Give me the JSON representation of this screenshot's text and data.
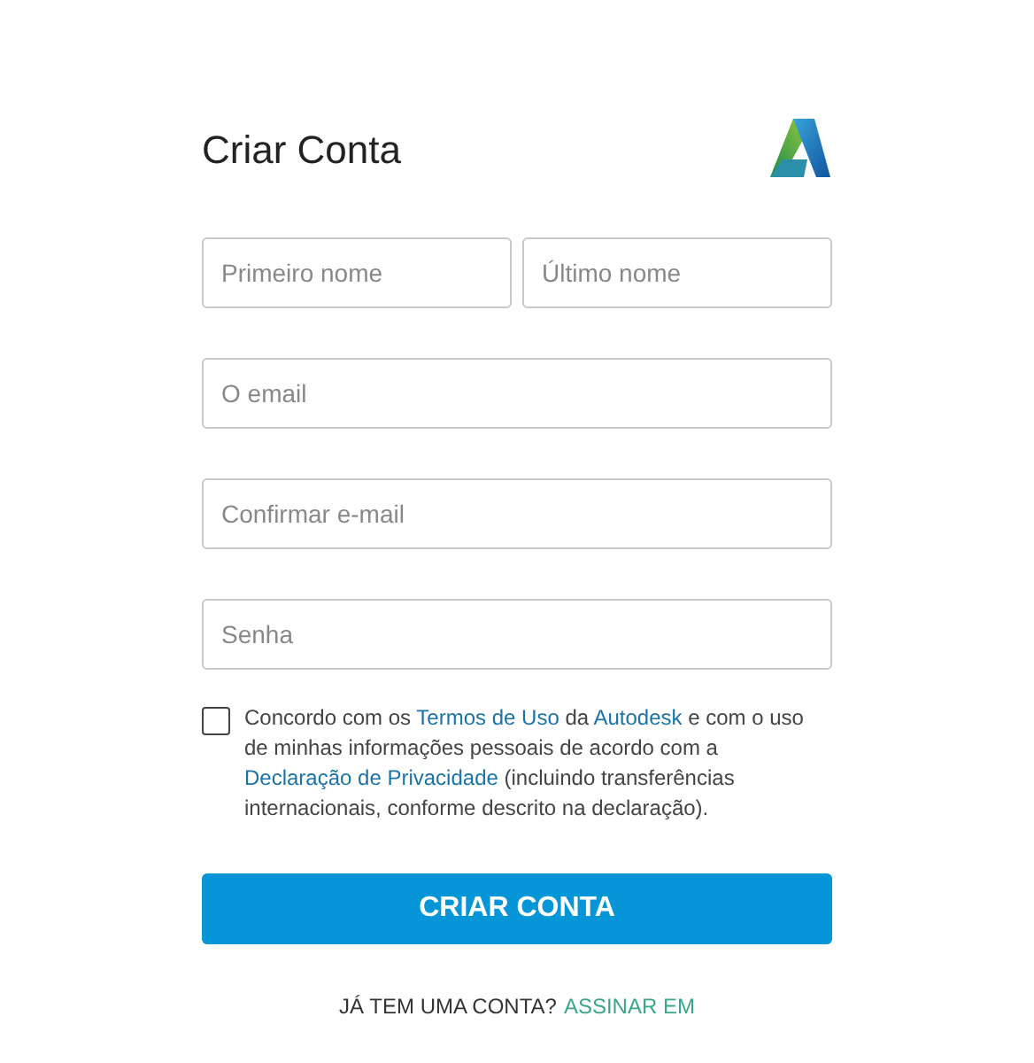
{
  "title": "Criar Conta",
  "field_rows": [
    [
      {
        "placeholder": "Primeiro nome"
      },
      {
        "placeholder": "Último nome"
      }
    ],
    [
      {
        "placeholder": "O email"
      }
    ],
    [
      {
        "placeholder": "Confirmar e-mail"
      }
    ],
    [
      {
        "placeholder": "Senha"
      }
    ]
  ],
  "consent": {
    "checked": false,
    "segments": [
      {
        "kind": "text",
        "text": "Concordo com os "
      },
      {
        "kind": "link",
        "text": "Termos de Uso"
      },
      {
        "kind": "text",
        "text": " da "
      },
      {
        "kind": "link",
        "text": "Autodesk"
      },
      {
        "kind": "text",
        "text": " e com o uso de minhas informações pessoais de acordo com a "
      },
      {
        "kind": "link",
        "text": "Declaração de Privacidade"
      },
      {
        "kind": "text",
        "text": " (incluindo transferências internacionais, conforme descrito na declaração)."
      }
    ]
  },
  "submit": "CRIAR CONTA",
  "footer": {
    "question": "JÁ TEM UMA CONTA?",
    "link": "ASSINAR EM"
  }
}
